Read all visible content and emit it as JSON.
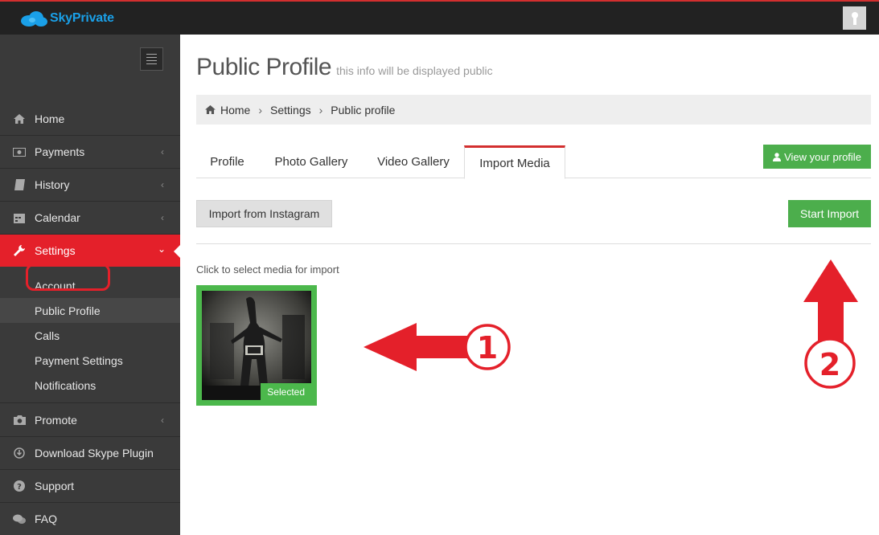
{
  "brand": {
    "name": "SkyPrivate",
    "accent": "#1aa0e8"
  },
  "topbar": {
    "avatar_icon": "user-avatar-icon"
  },
  "sidebar": {
    "items": [
      {
        "label": "Home",
        "icon": "home-icon"
      },
      {
        "label": "Payments",
        "icon": "money-icon"
      },
      {
        "label": "History",
        "icon": "book-icon"
      },
      {
        "label": "Calendar",
        "icon": "calendar-icon"
      },
      {
        "label": "Settings",
        "icon": "wrench-icon",
        "active": true
      },
      {
        "label": "Promote",
        "icon": "camera-icon"
      },
      {
        "label": "Download Skype Plugin",
        "icon": "download-icon"
      },
      {
        "label": "Support",
        "icon": "question-icon"
      },
      {
        "label": "FAQ",
        "icon": "comments-icon"
      }
    ],
    "settings_sub": [
      {
        "label": "Account"
      },
      {
        "label": "Public Profile",
        "current": true
      },
      {
        "label": "Calls"
      },
      {
        "label": "Payment Settings"
      },
      {
        "label": "Notifications"
      }
    ],
    "active_color": "#e4202a"
  },
  "page": {
    "title": "Public Profile",
    "subtitle": "this info will be displayed public",
    "breadcrumb": [
      "Home",
      "Settings",
      "Public profile"
    ]
  },
  "tabs": [
    {
      "label": "Profile"
    },
    {
      "label": "Photo Gallery"
    },
    {
      "label": "Video Gallery"
    },
    {
      "label": "Import Media",
      "active": true
    }
  ],
  "actions": {
    "view_profile": "View your profile",
    "import_instagram": "Import from Instagram",
    "start_import": "Start Import"
  },
  "media": {
    "hint": "Click to select media for import",
    "items": [
      {
        "badge": "Selected",
        "selected": true
      }
    ]
  },
  "annotations": [
    {
      "label": "1"
    },
    {
      "label": "2"
    }
  ]
}
